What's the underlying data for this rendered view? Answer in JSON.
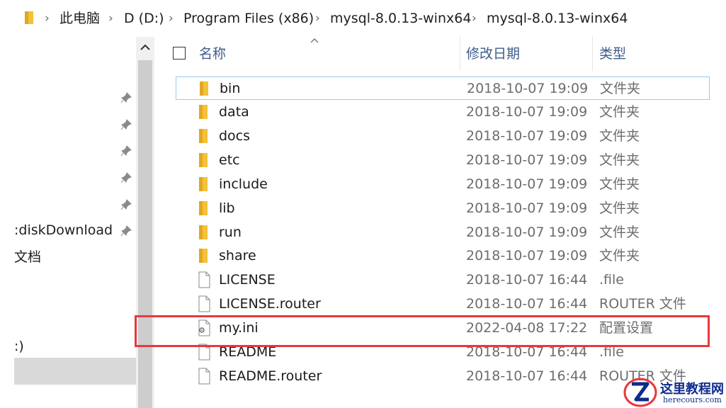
{
  "breadcrumb": {
    "items": [
      "此电脑",
      "D (D:)",
      "Program Files (x86)",
      "mysql-8.0.13-winx64",
      "mysql-8.0.13-winx64"
    ]
  },
  "nav": {
    "items": [
      ":diskDownload",
      "文档",
      ":)"
    ]
  },
  "columns": {
    "name": "名称",
    "modified": "修改日期",
    "type": "类型"
  },
  "files": [
    {
      "name": "bin",
      "date": "2018-10-07 19:09",
      "type": "文件夹",
      "icon": "folder-icon"
    },
    {
      "name": "data",
      "date": "2018-10-07 19:09",
      "type": "文件夹",
      "icon": "folder-icon"
    },
    {
      "name": "docs",
      "date": "2018-10-07 19:09",
      "type": "文件夹",
      "icon": "folder-icon"
    },
    {
      "name": "etc",
      "date": "2018-10-07 19:09",
      "type": "文件夹",
      "icon": "folder-icon"
    },
    {
      "name": "include",
      "date": "2018-10-07 19:09",
      "type": "文件夹",
      "icon": "folder-icon"
    },
    {
      "name": "lib",
      "date": "2018-10-07 19:09",
      "type": "文件夹",
      "icon": "folder-icon"
    },
    {
      "name": "run",
      "date": "2018-10-07 19:09",
      "type": "文件夹",
      "icon": "folder-icon"
    },
    {
      "name": "share",
      "date": "2018-10-07 19:09",
      "type": "文件夹",
      "icon": "folder-icon"
    },
    {
      "name": "LICENSE",
      "date": "2018-10-07 16:44",
      "type": ".file",
      "icon": "file-icon"
    },
    {
      "name": "LICENSE.router",
      "date": "2018-10-07 16:44",
      "type": "ROUTER 文件",
      "icon": "file-icon"
    },
    {
      "name": "my.ini",
      "date": "2022-04-08 17:22",
      "type": "配置设置",
      "icon": "settings-file-icon"
    },
    {
      "name": "README",
      "date": "2018-10-07 16:44",
      "type": ".file",
      "icon": "file-icon"
    },
    {
      "name": "README.router",
      "date": "2018-10-07 16:44",
      "type": "ROUTER 文件",
      "icon": "file-icon"
    }
  ],
  "watermark": {
    "title": "这里教程网",
    "url": "herecours.com"
  },
  "colors": {
    "folder": "#f3c13a",
    "highlight": "#e8383d",
    "header_text": "#3d5c8a",
    "watermark": "#0d2b8a"
  }
}
